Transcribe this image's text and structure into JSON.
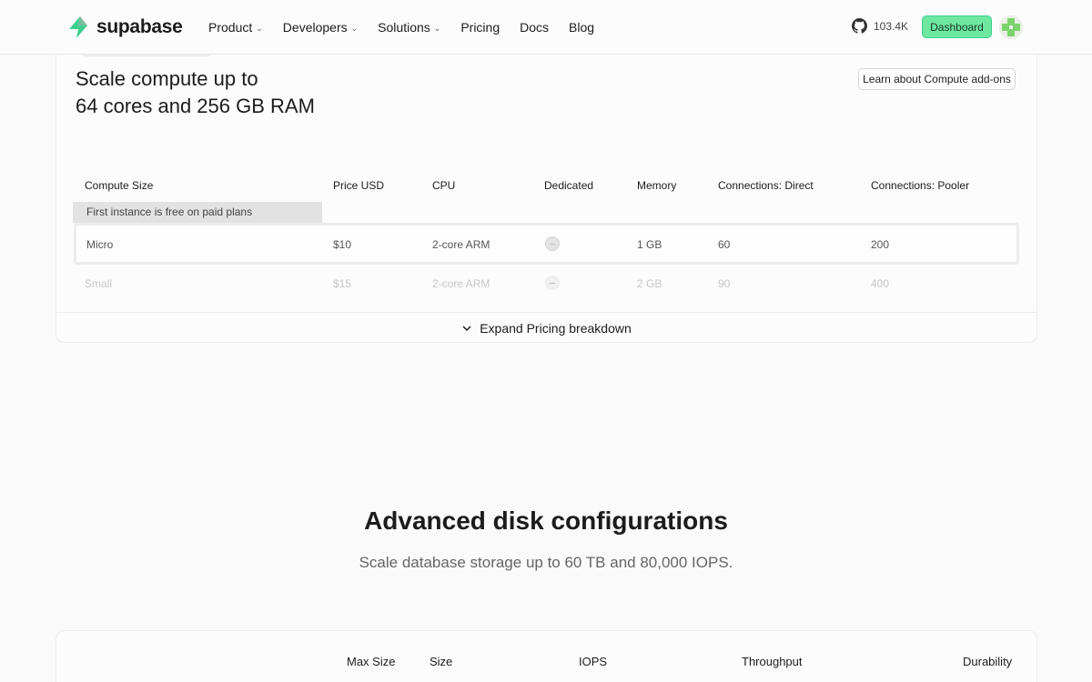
{
  "nav": {
    "logo_text": "supabase",
    "links": [
      {
        "label": "Product",
        "dropdown": true
      },
      {
        "label": "Developers",
        "dropdown": true
      },
      {
        "label": "Solutions",
        "dropdown": true
      },
      {
        "label": "Pricing",
        "dropdown": false
      },
      {
        "label": "Docs",
        "dropdown": false
      },
      {
        "label": "Blog",
        "dropdown": false
      }
    ],
    "github_stars": "103.4K",
    "dashboard_label": "Dashboard"
  },
  "compute": {
    "title_line1": "Scale compute up to",
    "title_line2": "64 cores and 256 GB RAM",
    "learn_label": "Learn about Compute add-ons",
    "headers": [
      "Compute Size",
      "Price USD",
      "CPU",
      "Dedicated",
      "Memory",
      "Connections: Direct",
      "Connections: Pooler"
    ],
    "free_note": "First instance is free on paid plans",
    "rows": [
      {
        "size": "Micro",
        "price": "$10",
        "cpu": "2-core ARM",
        "memory": "1 GB",
        "direct": "60",
        "pooler": "200"
      },
      {
        "size": "Small",
        "price": "$15",
        "cpu": "2-core ARM",
        "memory": "2 GB",
        "direct": "90",
        "pooler": "400"
      }
    ],
    "expand_label": "Expand Pricing breakdown"
  },
  "disk": {
    "title": "Advanced disk configurations",
    "subtitle": "Scale database storage up to 60 TB and 80,000 IOPS.",
    "headers": [
      "Max Size",
      "Size",
      "IOPS",
      "Throughput",
      "Durability"
    ]
  },
  "colors": {
    "brand_green": "#3ecf8e",
    "dashboard_bg": "#6ee7a0"
  }
}
